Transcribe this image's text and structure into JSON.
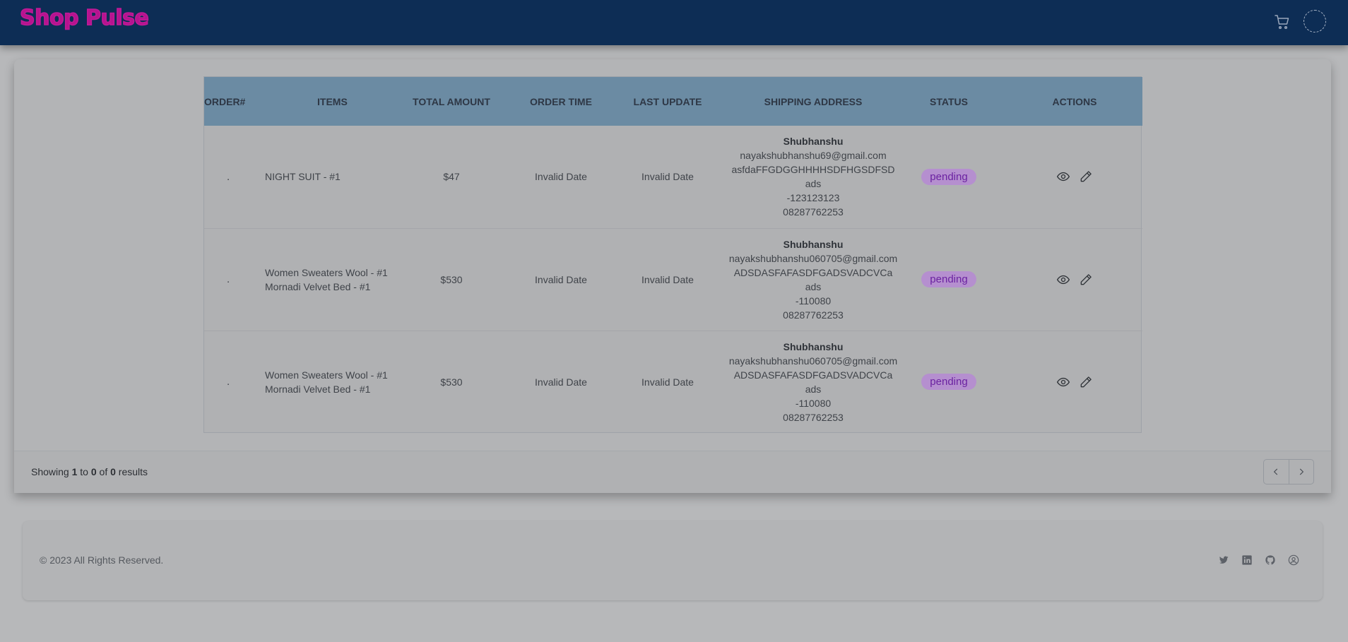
{
  "header": {
    "logo": "Shop Pulse",
    "icons": [
      "cart-icon",
      "avatar"
    ]
  },
  "table": {
    "columns": [
      "ORDER#",
      "ITEMS",
      "TOTAL AMOUNT",
      "ORDER TIME",
      "LAST UPDATE",
      "SHIPPING ADDRESS",
      "STATUS",
      "ACTIONS"
    ],
    "rows": [
      {
        "order": ".",
        "items": [
          "NIGHT SUIT - #1"
        ],
        "total": "$47",
        "order_time": "Invalid Date",
        "last_update": "Invalid Date",
        "address": {
          "name": "Shubhanshu",
          "email": "nayakshubhanshu69@gmail.com",
          "street": "asfdaFFGDGGHHHHSDFHGSDFSD",
          "city": "ads",
          "pin": "-123123123",
          "phone": "08287762253"
        },
        "status": "pending"
      },
      {
        "order": ".",
        "items": [
          "Women Sweaters Wool - #1",
          "Mornadi Velvet Bed - #1"
        ],
        "total": "$530",
        "order_time": "Invalid Date",
        "last_update": "Invalid Date",
        "address": {
          "name": "Shubhanshu",
          "email": "nayakshubhanshu060705@gmail.com",
          "street": "ADSDASFAFASDFGADSVADCVCa",
          "city": "ads",
          "pin": "-110080",
          "phone": "08287762253"
        },
        "status": "pending"
      },
      {
        "order": ".",
        "items": [
          "Women Sweaters Wool - #1",
          "Mornadi Velvet Bed - #1"
        ],
        "total": "$530",
        "order_time": "Invalid Date",
        "last_update": "Invalid Date",
        "address": {
          "name": "Shubhanshu",
          "email": "nayakshubhanshu060705@gmail.com",
          "street": "ADSDASFAFASDFGADSVADCVCa",
          "city": "ads",
          "pin": "-110080",
          "phone": "08287762253"
        },
        "status": "pending"
      }
    ]
  },
  "pagination": {
    "prefix": "Showing ",
    "from": "1",
    "to_word": " to ",
    "to": "0",
    "of_word": " of ",
    "total": "0",
    "suffix": " results"
  },
  "footer": {
    "copyright": "© 2023 All Rights Reserved.",
    "social_icons": [
      "twitter-icon",
      "linkedin-icon",
      "github-icon",
      "account-icon"
    ]
  },
  "colors": {
    "topbar": "#0d2d55",
    "logo": "#b6138f",
    "table_header": "#6b8ba3",
    "badge_bg": "#b58fcf",
    "badge_text": "#6b22a1"
  }
}
